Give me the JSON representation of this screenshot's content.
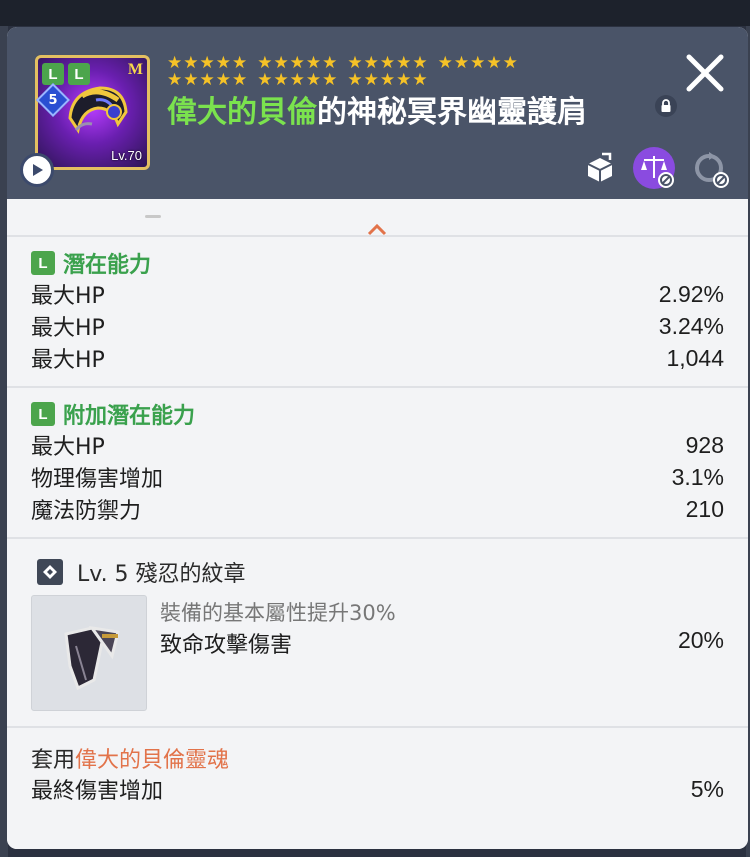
{
  "header": {
    "badge_L1": "L",
    "badge_L2": "L",
    "badge_M": "M",
    "badge_level": "5",
    "item_level": "Lv.70",
    "stars_row1": [
      "★★★★★",
      "★★★★★",
      "★★★★★",
      "★★★★★"
    ],
    "stars_row2": [
      "★★★★★",
      "★★★★★",
      "★★★★★"
    ],
    "title_highlight": "偉大的貝倫",
    "title_rest": "的神秘冥界幽靈護肩",
    "icons": [
      "box-transfer-icon",
      "scale-balance-icon",
      "recycle-icon"
    ]
  },
  "potential": {
    "badge": "L",
    "heading": "潛在能力",
    "rows": [
      {
        "label": "最大HP",
        "value": "2.92%"
      },
      {
        "label": "最大HP",
        "value": "3.24%"
      },
      {
        "label": "最大HP",
        "value": "1,044"
      }
    ]
  },
  "additional_potential": {
    "badge": "L",
    "heading": "附加潛在能力",
    "rows": [
      {
        "label": "最大HP",
        "value": "928"
      },
      {
        "label": "物理傷害增加",
        "value": "3.1%"
      },
      {
        "label": "魔法防禦力",
        "value": "210"
      }
    ]
  },
  "emblem": {
    "title": "Lv. 5 殘忍的紋章",
    "description": "裝備的基本屬性提升30%",
    "stat_label": "致命攻擊傷害",
    "stat_value": "20%"
  },
  "set_effect": {
    "prefix": "套用",
    "highlight": "偉大的貝倫靈魂",
    "stat_label": "最終傷害增加",
    "stat_value": "5%"
  },
  "colors": {
    "header_bg": "#4a5468",
    "panel_bg": "#f3f4f6",
    "potential_green": "#3aa14d",
    "set_orange": "#e2734a",
    "title_green": "#7be24e",
    "star_gold": "#f5c227"
  }
}
